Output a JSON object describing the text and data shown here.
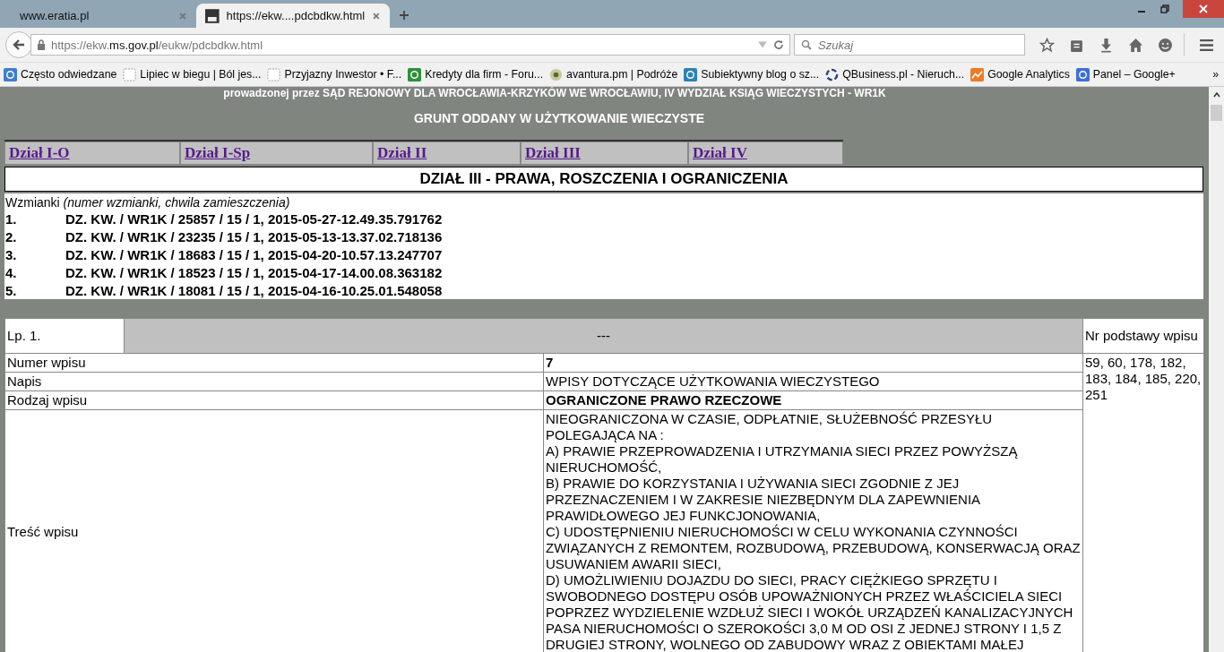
{
  "browser": {
    "tabs": [
      {
        "label": "www.eratia.pl",
        "selected": false
      },
      {
        "label": "https://ekw....pdcbdkw.html",
        "selected": true
      }
    ],
    "address": {
      "prefix": "https://ekw.",
      "domain": "ms.gov.pl",
      "suffix": "/eukw/pdcbdkw.html"
    },
    "search": {
      "placeholder": "Szukaj"
    },
    "bookmarks": [
      {
        "label": "Często odwiedzane",
        "kind": "frequent"
      },
      {
        "label": "Lipiec w biegu | Ból jes...",
        "kind": "blank"
      },
      {
        "label": "Przyjazny Inwestor • F...",
        "kind": "blank"
      },
      {
        "label": "Kredyty dla firm - Foru...",
        "kind": "square"
      },
      {
        "label": "avantura.pm | Podróże",
        "kind": "flower"
      },
      {
        "label": "Subiektywny blog o sz...",
        "kind": "circle"
      },
      {
        "label": "QBusiness.pl - Nieruch...",
        "kind": "swirl"
      },
      {
        "label": "Google Analytics",
        "kind": "chart"
      },
      {
        "label": "Panel – Google+",
        "kind": "store"
      }
    ],
    "overflow": "»"
  },
  "page": {
    "court_line": "prowadzonej przez SĄD REJONOWY DLA WROCŁAWIA-KRZYKÓW WE WROCŁAWIU, IV WYDZIAŁ KSIĄG WIECZYSTYCH - WR1K",
    "subtitle": "GRUNT ODDANY W UŻYTKOWANIE WIECZYSTE",
    "sections": [
      {
        "label": "Dział I-O"
      },
      {
        "label": "Dział I-Sp"
      },
      {
        "label": "Dział II"
      },
      {
        "label": "Dział III"
      },
      {
        "label": "Dział IV"
      }
    ],
    "section_title": "DZIAŁ III - PRAWA, ROSZCZENIA I OGRANICZENIA",
    "mentions_heading": "Wzmianki *(numer wzmianki, chwila zamieszczenia)*",
    "mentions": [
      {
        "number": "1.",
        "text": "DZ. KW. / WR1K / 25857 / 15 / 1, 2015-05-27-12.49.35.791762"
      },
      {
        "number": "2.",
        "text": "DZ. KW. / WR1K / 23235 / 15 / 1, 2015-05-13-13.37.02.718136"
      },
      {
        "number": "3.",
        "text": "DZ. KW. / WR1K / 18683 / 15 / 1, 2015-04-20-10.57.13.247707"
      },
      {
        "number": "4.",
        "text": "DZ. KW. / WR1K / 18523 / 15 / 1, 2015-04-17-14.00.08.363182"
      },
      {
        "number": "5.",
        "text": "DZ. KW. / WR1K / 18081 / 15 / 1, 2015-04-16-10.25.01.548058"
      }
    ],
    "entry": {
      "lp": "Lp. 1.",
      "status": "---",
      "basis_heading": "Nr podstawy wpisu",
      "basis": "59, 60, 178, 182, 183, 184, 185, 220, 251",
      "rows": [
        {
          "label": "Numer wpisu",
          "value": "7",
          "bold": true
        },
        {
          "label": "Napis",
          "value": "WPISY DOTYCZĄCE UŻYTKOWANIA WIECZYSTEGO",
          "bold": false
        },
        {
          "label": "Rodzaj wpisu",
          "value": "OGRANICZONE PRAWO RZECZOWE",
          "bold": true
        },
        {
          "label": "Treść wpisu",
          "bold": false,
          "lines": [
            "NIEOGRANICZONA W CZASIE, ODPŁATNIE, SŁUŻEBNOŚĆ PRZESYŁU POLEGAJĄCA NA :",
            "A) PRAWIE PRZEPROWADZENIA I UTRZYMANIA SIECI PRZEZ POWYŻSZĄ NIERUCHOMOŚĆ,",
            "B) PRAWIE DO KORZYSTANIA I UŻYWANIA SIECI ZGODNIE Z JEJ PRZEZNACZENIEM I W ZAKRESIE NIEZBĘDNYM DLA ZAPEWNIENIA PRAWIDŁOWEGO JEJ FUNKCJONOWANIA,",
            "C) UDOSTĘPNIENIU NIERUCHOMOŚCI W CELU WYKONANIA CZYNNOŚCI ZWIĄZANYCH Z REMONTEM, ROZBUDOWĄ, PRZEBUDOWĄ, KONSERWACJĄ ORAZ USUWANIEM AWARII SIECI,",
            "D) UMOŻLIWIENIU DOJAZDU DO SIECI, PRACY CIĘŻKIEGO SPRZĘTU I SWOBODNEGO DOSTĘPU OSÓB UPOWAŻNIONYCH PRZEZ WŁAŚCICIELA SIECI POPRZEZ WYDZIELENIE WZDŁUŻ SIECI I WOKÓŁ URZĄDZEŃ KANALIZACYJNYCH PASA NIERUCHOMOŚCI O SZEROKOŚCI 3,0 M OD OSI Z JEDNEJ STRONY I 1,5 Z DRUGIEJ STRONY, WOLNEGO OD ZABUDOWY WRAZ Z OBIEKTAMI MAŁEJ"
          ]
        }
      ]
    }
  }
}
